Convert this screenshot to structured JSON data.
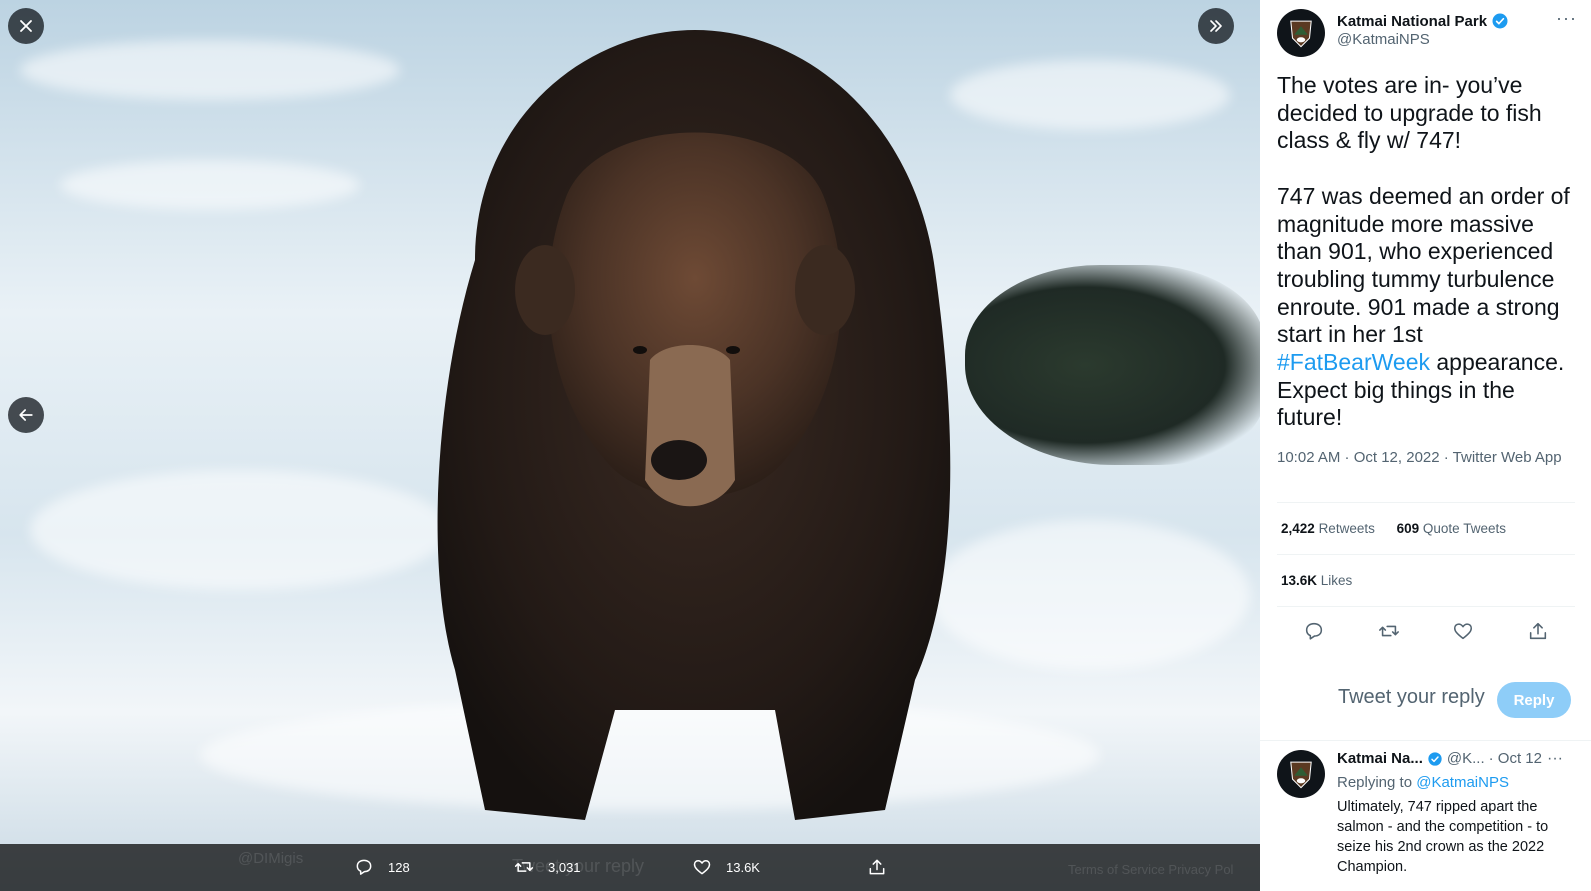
{
  "viewer": {
    "close_icon": "close-icon",
    "next_icon": "double-chevron-right-icon",
    "prev_icon": "arrow-left-icon",
    "ghost_name": "@DIMigis",
    "ghost_reply_placeholder": "Tweet your reply",
    "ghost_footer": "Terms of Service   Privacy Pol",
    "bar": {
      "replies": "128",
      "retweets": "3,031",
      "likes": "13.6K"
    }
  },
  "tweet": {
    "author_name": "Katmai National Park",
    "author_handle": "@KatmaiNPS",
    "text_part1": "The votes are in- you’ve decided to upgrade to fish class & fly w/ 747!\n\n747 was deemed an order of magnitude more massive than 901, who experienced troubling tummy turbulence enroute. 901 made a strong start in her 1st ",
    "hashtag": "#FatBearWeek",
    "text_part2": " appearance. Expect big things in the future!",
    "meta": "10:02 AM · Oct 12, 2022 · Twitter Web App",
    "retweets_count": "2,422",
    "retweets_label": "Retweets",
    "quotes_count": "609",
    "quotes_label": "Quote Tweets",
    "likes_count": "13.6K",
    "likes_label": "Likes",
    "more": "···"
  },
  "reply_composer": {
    "placeholder": "Tweet your reply",
    "button": "Reply"
  },
  "reply": {
    "name": "Katmai Na...",
    "handle": "@K...",
    "date": "· Oct 12",
    "replying_label": "Replying to",
    "replying_to": "@KatmaiNPS",
    "text": "Ultimately, 747 ripped apart the salmon - and the competition - to seize his 2nd crown as the 2022 Champion."
  },
  "colors": {
    "accent": "#1d9bf0",
    "reply_button": "#8ecdf8",
    "secondary_text": "#536471"
  }
}
